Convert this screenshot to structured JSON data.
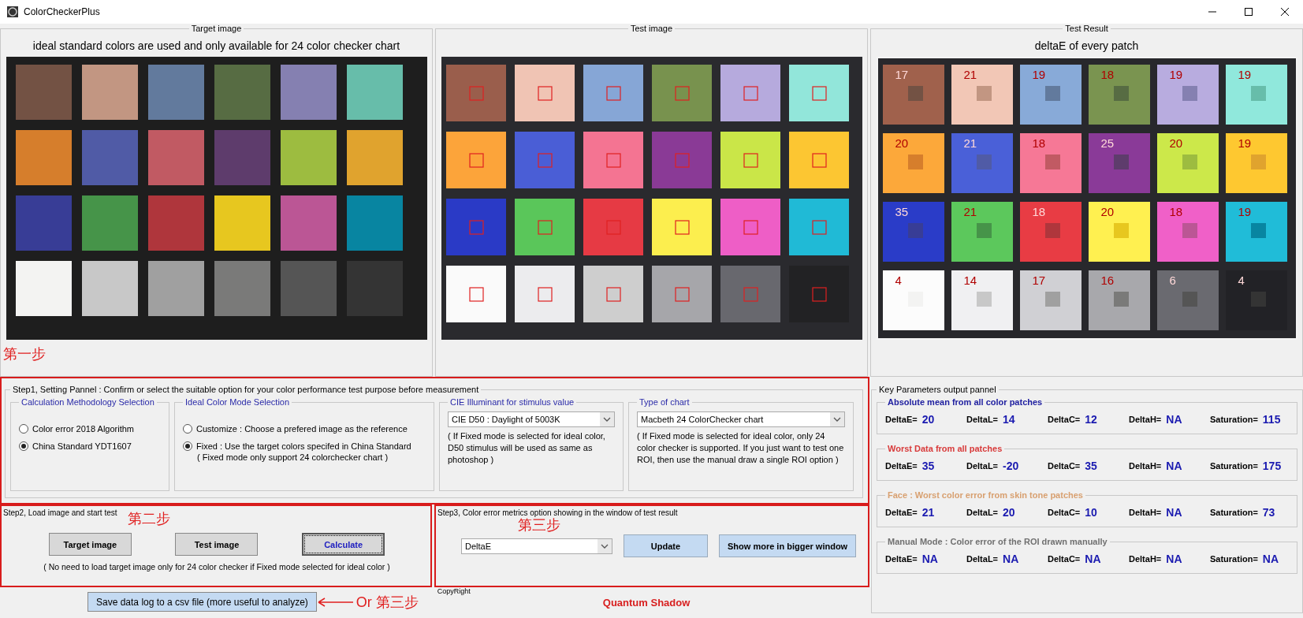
{
  "window": {
    "title": "ColorCheckerPlus"
  },
  "target_panel": {
    "title": "Target image",
    "caption": "ideal standard colors are used and only available for 24 color checker chart",
    "patches": [
      {
        "color": "#735244"
      },
      {
        "color": "#c29682"
      },
      {
        "color": "#627a9d"
      },
      {
        "color": "#576c43"
      },
      {
        "color": "#8580b1"
      },
      {
        "color": "#67bdaa"
      },
      {
        "color": "#d67e2c"
      },
      {
        "color": "#505ba6"
      },
      {
        "color": "#c15a63"
      },
      {
        "color": "#5e3c6c"
      },
      {
        "color": "#9dbc40"
      },
      {
        "color": "#e0a32e"
      },
      {
        "color": "#383d96"
      },
      {
        "color": "#469449"
      },
      {
        "color": "#af363c"
      },
      {
        "color": "#e7c71f"
      },
      {
        "color": "#bb5695"
      },
      {
        "color": "#0885a1"
      },
      {
        "color": "#f3f3f2"
      },
      {
        "color": "#c8c8c8"
      },
      {
        "color": "#a0a0a0"
      },
      {
        "color": "#7a7a79"
      },
      {
        "color": "#555555"
      },
      {
        "color": "#343434"
      }
    ],
    "step_note": "第一步"
  },
  "test_panel": {
    "title": "Test image"
  },
  "result_panel": {
    "title": "Test Result",
    "caption": "deltaE of every patch",
    "patches": [
      {
        "color": "#a0614c",
        "value": "17"
      },
      {
        "color": "#f2c7b6",
        "value": "21"
      },
      {
        "color": "#88aad8",
        "value": "19"
      },
      {
        "color": "#7a9450",
        "value": "18"
      },
      {
        "color": "#b8acdf",
        "value": "19"
      },
      {
        "color": "#90e8dc",
        "value": "19"
      },
      {
        "color": "#fca83a",
        "value": "20"
      },
      {
        "color": "#4a60d8",
        "value": "21"
      },
      {
        "color": "#f67896",
        "value": "18"
      },
      {
        "color": "#8a3a98",
        "value": "25"
      },
      {
        "color": "#cce84a",
        "value": "20"
      },
      {
        "color": "#fec830",
        "value": "19"
      },
      {
        "color": "#2a3cc8",
        "value": "35"
      },
      {
        "color": "#5cc85c",
        "value": "21"
      },
      {
        "color": "#e83c44",
        "value": "18"
      },
      {
        "color": "#fff050",
        "value": "20"
      },
      {
        "color": "#f060c8",
        "value": "18"
      },
      {
        "color": "#20bcd8",
        "value": "19"
      },
      {
        "color": "#fcfcfc",
        "value": "4"
      },
      {
        "color": "#f0f0f2",
        "value": "14"
      },
      {
        "color": "#d0d0d4",
        "value": "17"
      },
      {
        "color": "#a8a8ac",
        "value": "16"
      },
      {
        "color": "#6a6a70",
        "value": "6"
      },
      {
        "color": "#222226",
        "value": "4"
      }
    ]
  },
  "step1": {
    "title": "Step1, Setting Pannel : Confirm or select the suitable option for your color performance test purpose before measurement",
    "groups": [
      {
        "kind": "radio",
        "title": "Calculation Methodology Selection",
        "options": [
          {
            "label": "Color error 2018 Algorithm",
            "selected": false
          },
          {
            "label": "China Standard YDT1607",
            "selected": true
          }
        ]
      },
      {
        "kind": "radio",
        "title": "Ideal Color Mode Selection",
        "options": [
          {
            "label": "Customize : Choose a prefered image as the reference",
            "selected": false
          },
          {
            "label": "Fixed : Use the target colors specifed in China Standard",
            "selected": true
          }
        ],
        "note": "( Fixed mode only support 24 colorchecker chart )"
      },
      {
        "kind": "dropdown",
        "title": "CIE Illuminant for stimulus value",
        "value": "CIE D50 : Daylight of 5003K",
        "note": "( If Fixed mode is selected for ideal color, D50 stimulus will be used as same as photoshop )"
      },
      {
        "kind": "dropdown",
        "title": "Type of chart",
        "value": "Macbeth 24 ColorChecker chart",
        "note": "( If Fixed mode is selected for ideal color, only 24 color checker is supported. If you just want to test one ROI, then use the manual draw a single ROI option )"
      }
    ]
  },
  "step2": {
    "title": "Step2, Load image and start test",
    "step_note": "第二步",
    "buttons": [
      {
        "label": "Target image",
        "focused": false
      },
      {
        "label": "Test image",
        "focused": false
      },
      {
        "label": "Calculate",
        "focused": true
      }
    ],
    "note": "( No need to load target image only for 24 color checker if Fixed mode selected for ideal color )"
  },
  "step3": {
    "title": "Step3, Color error metrics option showing in the window of test result",
    "step_note": "第三步",
    "dropdown": {
      "value": "DeltaE"
    },
    "buttons": [
      "Update",
      "Show more in bigger window"
    ]
  },
  "save_button": {
    "label": "Save data log to a csv file (more useful to analyze)"
  },
  "save_note": "Or 第三步",
  "copyright": {
    "title": "CopyRight",
    "name": "Quantum Shadow"
  },
  "key_params": {
    "title": "Key Parameters output pannel",
    "groups": [
      {
        "title": "Absolute mean from all color patches",
        "color": "#2020a0",
        "metrics": [
          {
            "label": "DeltaE=",
            "value": "20"
          },
          {
            "label": "DeltaL=",
            "value": "14"
          },
          {
            "label": "DeltaC=",
            "value": "12"
          },
          {
            "label": "DeltaH=",
            "value": "NA"
          },
          {
            "label": "Saturation=",
            "value": "115"
          }
        ]
      },
      {
        "title": "Worst Data from all patches",
        "color": "#d83a3a",
        "metrics": [
          {
            "label": "DeltaE=",
            "value": "35"
          },
          {
            "label": "DeltaL=",
            "value": "-20"
          },
          {
            "label": "DeltaC=",
            "value": "35"
          },
          {
            "label": "DeltaH=",
            "value": "NA"
          },
          {
            "label": "Saturation=",
            "value": "175"
          }
        ]
      },
      {
        "title": "Face : Worst color error from skin tone patches",
        "color": "#d8a070",
        "metrics": [
          {
            "label": "DeltaE=",
            "value": "21"
          },
          {
            "label": "DeltaL=",
            "value": "20"
          },
          {
            "label": "DeltaC=",
            "value": "10"
          },
          {
            "label": "DeltaH=",
            "value": "NA"
          },
          {
            "label": "Saturation=",
            "value": "73"
          }
        ]
      },
      {
        "title": "Manual Mode : Color error of the ROI drawn manually",
        "color": "#707070",
        "metrics": [
          {
            "label": "DeltaE=",
            "value": "NA"
          },
          {
            "label": "DeltaL=",
            "value": "NA"
          },
          {
            "label": "DeltaC=",
            "value": "NA"
          },
          {
            "label": "DeltaH=",
            "value": "NA"
          },
          {
            "label": "Saturation=",
            "value": "NA"
          }
        ]
      }
    ]
  }
}
